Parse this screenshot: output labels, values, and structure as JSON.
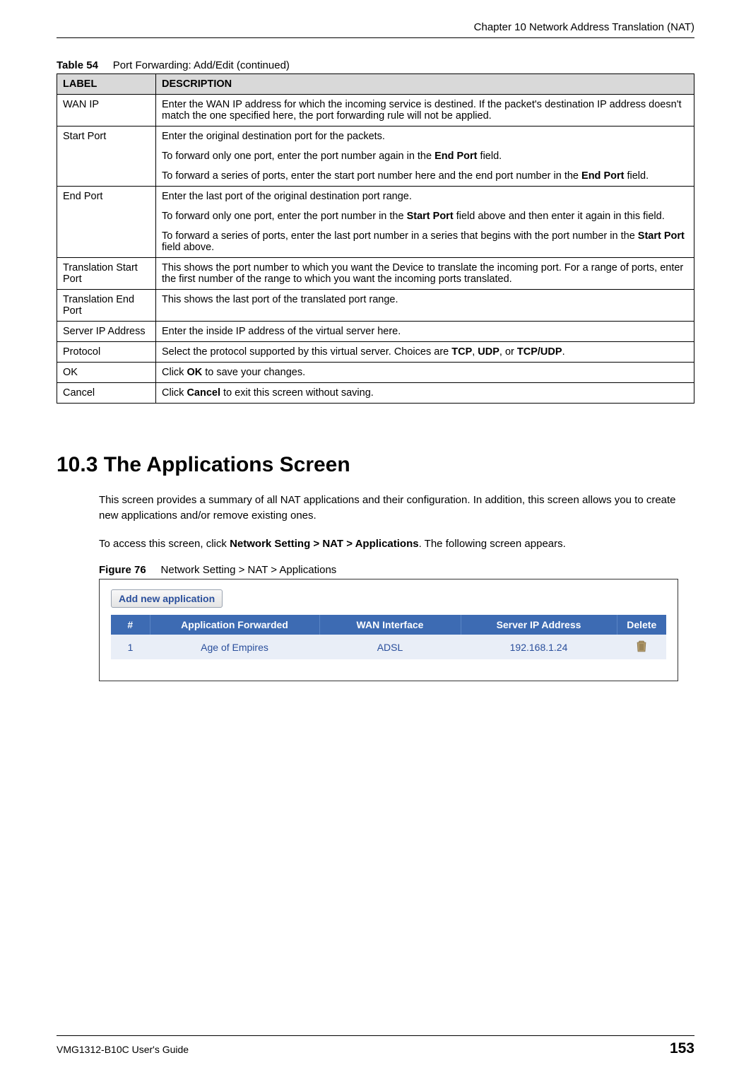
{
  "header": {
    "chapter_title": "Chapter 10 Network Address Translation (NAT)"
  },
  "table54": {
    "caption_prefix": "Table 54",
    "caption_text": "Port Forwarding: Add/Edit (continued)",
    "headers": {
      "label": "LABEL",
      "description": "DESCRIPTION"
    },
    "rows": {
      "wan_ip": {
        "label": "WAN IP",
        "desc": "Enter the WAN IP address for which the incoming service is destined. If the packet's destination IP address doesn't match the one specified here, the port forwarding rule will not be applied."
      },
      "start_port": {
        "label": "Start Port",
        "p1": "Enter the original destination port for the packets.",
        "p2a": "To forward only one port, enter the port number again in the ",
        "p2b_bold": "End Port",
        "p2c": " field.",
        "p3a": "To forward a series of ports, enter the start port number here and the end port number in the ",
        "p3b_bold": "End Port",
        "p3c": " field."
      },
      "end_port": {
        "label": "End Port",
        "p1": "Enter the last port of the original destination port range.",
        "p2a": "To forward only one port, enter the port number in the ",
        "p2b_bold": "Start Port",
        "p2c": " field above and then enter it again in this field.",
        "p3a": "To forward a series of ports, enter the last port number in a series that begins with the port number in the ",
        "p3b_bold": "Start Port",
        "p3c": " field above."
      },
      "trans_start": {
        "label": "Translation Start Port",
        "desc": "This shows the port number to which you want the Device to translate the incoming port. For a range of ports, enter the first number of the range to which you want the incoming ports translated."
      },
      "trans_end": {
        "label": "Translation End Port",
        "desc": "This shows the last port of the translated port range."
      },
      "server_ip": {
        "label": "Server IP Address",
        "desc": "Enter the inside IP address of the virtual server here."
      },
      "protocol": {
        "label": "Protocol",
        "p1a": "Select the protocol supported by this virtual server. Choices are ",
        "b1": "TCP",
        "sep1": ", ",
        "b2": "UDP",
        "sep2": ", or ",
        "b3": "TCP/UDP",
        "end": "."
      },
      "ok": {
        "label": "OK",
        "p1a": "Click ",
        "b1": "OK",
        "p1b": " to save your changes."
      },
      "cancel": {
        "label": "Cancel",
        "p1a": "Click ",
        "b1": "Cancel",
        "p1b": " to exit this screen without saving."
      }
    }
  },
  "section": {
    "heading": "10.3  The Applications Screen",
    "p1": "This screen provides a summary of all NAT applications and their configuration. In addition, this screen allows you to create new applications and/or remove existing ones.",
    "p2a": "To access this screen, click ",
    "p2b_bold": "Network Setting > NAT > Applications",
    "p2c": ". The following screen appears."
  },
  "figure76": {
    "caption_prefix": "Figure 76",
    "caption_text": "Network Setting > NAT > Applications",
    "add_button": "Add new application",
    "headers": {
      "num": "#",
      "app_forwarded": "Application Forwarded",
      "wan_interface": "WAN Interface",
      "server_ip": "Server IP Address",
      "delete": "Delete"
    },
    "row1": {
      "num": "1",
      "app": "Age of Empires",
      "wan": "ADSL",
      "ip": "192.168.1.24"
    }
  },
  "footer": {
    "guide": "VMG1312-B10C User's Guide",
    "page": "153"
  }
}
